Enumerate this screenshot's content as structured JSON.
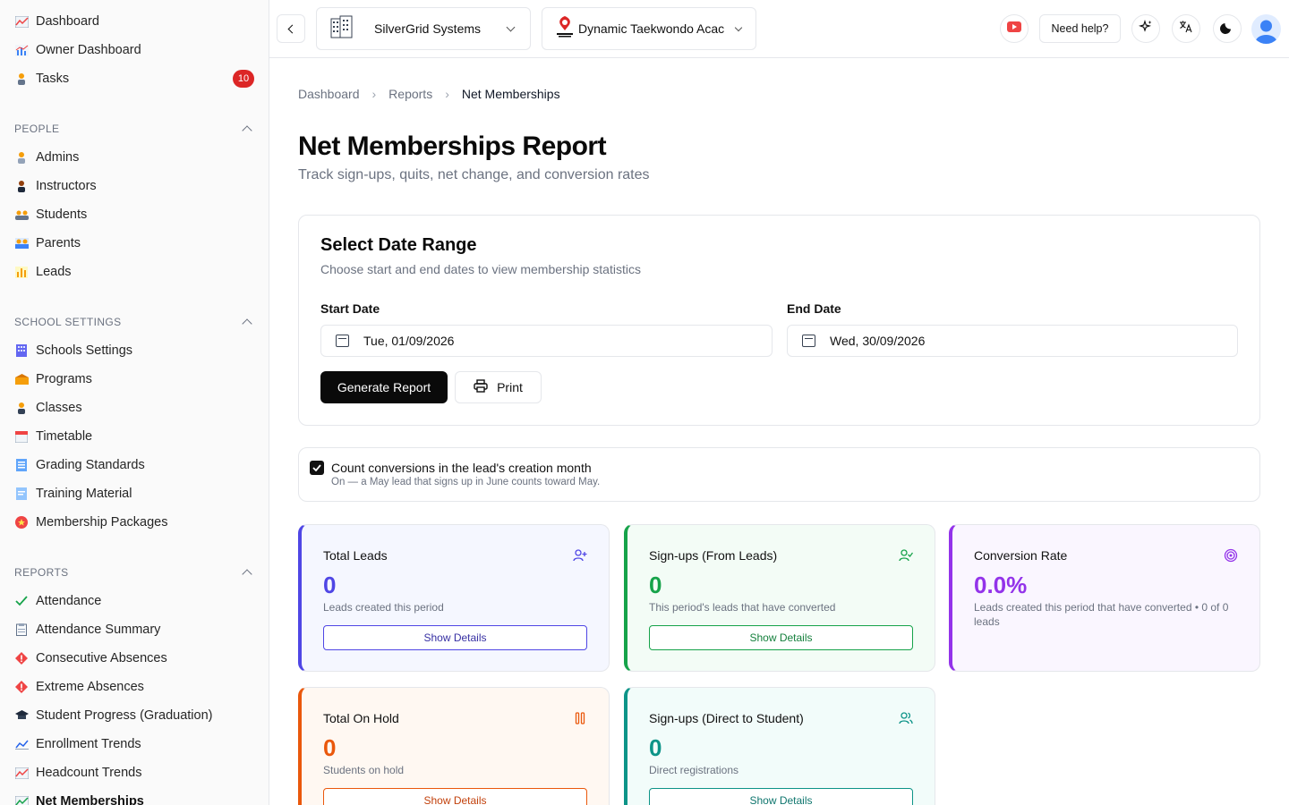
{
  "sidebar": {
    "top_items": [
      {
        "label": "Dashboard",
        "icon": "chart-icon"
      },
      {
        "label": "Owner Dashboard",
        "icon": "bar-chart-icon"
      },
      {
        "label": "Tasks",
        "icon": "person-icon",
        "badge": "10"
      }
    ],
    "sections": [
      {
        "title": "PEOPLE",
        "items": [
          {
            "label": "Admins"
          },
          {
            "label": "Instructors"
          },
          {
            "label": "Students"
          },
          {
            "label": "Parents"
          },
          {
            "label": "Leads"
          }
        ]
      },
      {
        "title": "SCHOOL SETTINGS",
        "items": [
          {
            "label": "Schools Settings"
          },
          {
            "label": "Programs"
          },
          {
            "label": "Classes"
          },
          {
            "label": "Timetable"
          },
          {
            "label": "Grading Standards"
          },
          {
            "label": "Training Material"
          },
          {
            "label": "Membership Packages"
          }
        ]
      },
      {
        "title": "REPORTS",
        "items": [
          {
            "label": "Attendance"
          },
          {
            "label": "Attendance Summary"
          },
          {
            "label": "Consecutive Absences"
          },
          {
            "label": "Extreme Absences"
          },
          {
            "label": "Student Progress (Graduation)"
          },
          {
            "label": "Enrollment Trends"
          },
          {
            "label": "Headcount Trends"
          },
          {
            "label": "Net Memberships"
          }
        ]
      }
    ]
  },
  "topbar": {
    "org": "SilverGrid Systems",
    "school": "Dynamic Taekwondo Acac",
    "help": "Need help?"
  },
  "breadcrumb": [
    "Dashboard",
    "Reports",
    "Net Memberships"
  ],
  "page": {
    "title": "Net Memberships Report",
    "subtitle": "Track sign-ups, quits, net change, and conversion rates"
  },
  "date_range": {
    "title": "Select Date Range",
    "subtitle": "Choose start and end dates to view membership statistics",
    "start_label": "Start Date",
    "start_value": "Tue, 01/09/2026",
    "end_label": "End Date",
    "end_value": "Wed, 30/09/2026",
    "generate": "Generate Report",
    "print": "Print"
  },
  "option": {
    "label": "Count conversions in the lead's creation month",
    "hint": "On — a May lead that signs up in June counts toward May.",
    "checked": true
  },
  "stats": [
    {
      "title": "Total Leads",
      "value": "0",
      "desc": "Leads created this period",
      "button": "Show Details",
      "color": "#4f46e5",
      "bg": "#f5f7ff"
    },
    {
      "title": "Sign-ups (From Leads)",
      "value": "0",
      "desc": "This period's leads that have converted",
      "button": "Show Details",
      "color": "#16a34a",
      "bg": "#f3fcf6"
    },
    {
      "title": "Conversion Rate",
      "value": "0.0%",
      "desc": "Leads created this period that have converted • 0 of 0 leads",
      "color": "#9333ea",
      "bg": "#faf6ff"
    },
    {
      "title": "Total On Hold",
      "value": "0",
      "desc": "Students on hold",
      "button": "Show Details",
      "color": "#ea580c",
      "bg": "#fff8f2"
    },
    {
      "title": "Sign-ups (Direct to Student)",
      "value": "0",
      "desc": "Direct registrations",
      "button": "Show Details",
      "color": "#0d9488",
      "bg": "#f2fcfa"
    }
  ]
}
